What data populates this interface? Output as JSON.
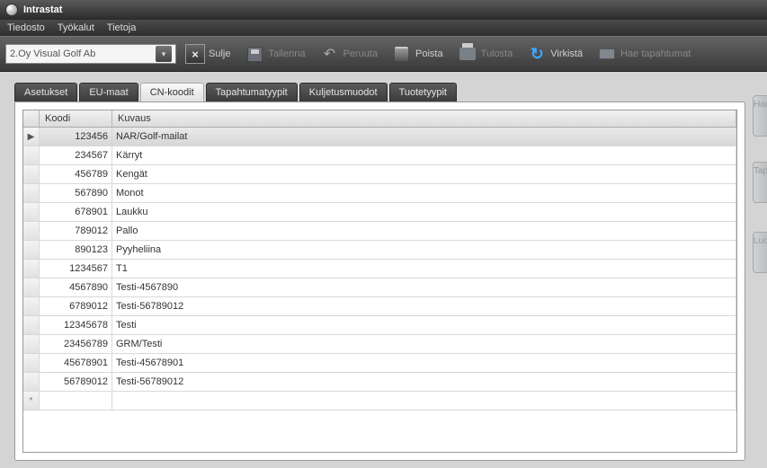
{
  "window": {
    "title": "Intrastat"
  },
  "menu": {
    "file": "Tiedosto",
    "tools": "Työkalut",
    "about": "Tietoja"
  },
  "toolbar": {
    "company": "2.Oy Visual Golf Ab",
    "close": "Sulje",
    "save": "Tallenna",
    "cancel": "Peruuta",
    "delete": "Poista",
    "print": "Tulosta",
    "refresh": "Virkistä",
    "fetch": "Hae tapahtumat"
  },
  "tabs": {
    "settings": "Asetukset",
    "eu": "EU-maat",
    "cn": "CN-koodit",
    "events": "Tapahtumatyypit",
    "transport": "Kuljetusmuodot",
    "product": "Tuotetyypit"
  },
  "grid": {
    "headers": {
      "code": "Koodi",
      "desc": "Kuvaus"
    },
    "rows": [
      {
        "code": "123456",
        "desc": "NAR/Golf-mailat"
      },
      {
        "code": "234567",
        "desc": "Kärryt"
      },
      {
        "code": "456789",
        "desc": "Kengät"
      },
      {
        "code": "567890",
        "desc": "Monot"
      },
      {
        "code": "678901",
        "desc": "Laukku"
      },
      {
        "code": "789012",
        "desc": "Pallo"
      },
      {
        "code": "890123",
        "desc": "Pyyheliina"
      },
      {
        "code": "1234567",
        "desc": "T1"
      },
      {
        "code": "4567890",
        "desc": "Testi-4567890"
      },
      {
        "code": "6789012",
        "desc": "Testi-56789012"
      },
      {
        "code": "12345678",
        "desc": "Testi"
      },
      {
        "code": "23456789",
        "desc": "GRM/Testi"
      },
      {
        "code": "45678901",
        "desc": "Testi-45678901"
      },
      {
        "code": "56789012",
        "desc": "Testi-56789012"
      }
    ]
  },
  "side": {
    "hae": "Hae",
    "tap": "Tap",
    "luo": "Luo"
  }
}
